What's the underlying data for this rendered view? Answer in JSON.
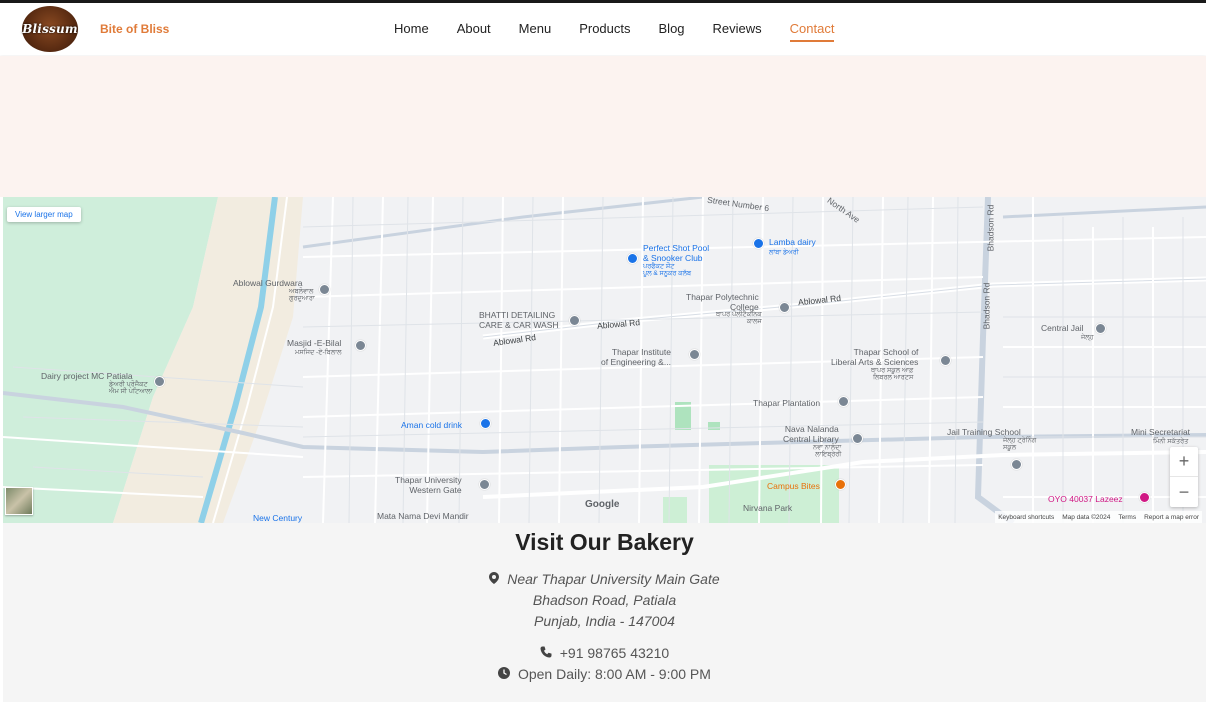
{
  "header": {
    "logo_text": "Blissum",
    "brand": "Bite of Bliss",
    "nav": [
      {
        "label": "Home",
        "active": false
      },
      {
        "label": "About",
        "active": false
      },
      {
        "label": "Menu",
        "active": false
      },
      {
        "label": "Products",
        "active": false
      },
      {
        "label": "Blog",
        "active": false
      },
      {
        "label": "Reviews",
        "active": false
      },
      {
        "label": "Contact",
        "active": true
      }
    ],
    "accent_color": "#e07b39"
  },
  "map": {
    "view_larger": "View larger map",
    "google": "Google",
    "zoom_in": "+",
    "zoom_out": "−",
    "attribution": [
      "Keyboard shortcuts",
      "Map data ©2024",
      "Terms",
      "Report a map error"
    ],
    "labels": {
      "street6": "Street Number 6",
      "north_ave": "North Ave",
      "bhadson_rd_top": "Bhadson Rd",
      "bhadson_rd_mid": "Bhadson Rd",
      "perfect_shot": "Perfect Shot Pool\n& Snooker Club",
      "perfect_shot_local": "ਪਰਫੈਕਟ ਸ਼ੌਟ\nਪੂਲ & ਸਨੂਕਰ ਕਲੱਬ",
      "lamba_dairy": "Lamba dairy",
      "lamba_dairy_local": "ਲਾਂਬਾ ਡੇਅਰੀ",
      "ablowal_gurdwara": "Ablowal Gurdwara",
      "ablowal_gurdwara_local": "ਅਬਲੋਵਾਲ\nਗੁਰਦੁਆਰਾ",
      "thapar_poly": "Thapar Polytechnic\nCollege",
      "thapar_poly_local": "ਥਾਪਰ ਪੌਲੀਟੈਕਨਿਕ\nਕਾਲਜ",
      "ablowal_rd_1": "Ablowal Rd",
      "ablowal_rd_2": "Ablowal Rd",
      "ablowal_rd_3": "Ablowal Rd",
      "bhatti": "BHATTI DETAILING\nCARE & CAR WASH",
      "masjid": "Masjid -E-Bilal",
      "masjid_local": "ਮਸਜਿਦ -ਏ-ਬਿਲਾਲ",
      "central_jail": "Central Jail",
      "central_jail_local": "ਜੇਲ੍ਹ",
      "thapar_inst": "Thapar Institute\nof Engineering &...",
      "thapar_school": "Thapar School of\nLiberal Arts & Sciences",
      "thapar_school_local": "ਥਾਪਰ ਸਕੂਲ ਆਫ਼\nਲਿਬਰਲ ਆਰਟਸ",
      "dairy_project": "Dairy project MC Patiala",
      "dairy_project_local": "ਡੇਅਰੀ ਪ੍ਰੋਜੈਕਟ\nਐਮ ਸੀ ਪਟਿਆਲਾ",
      "thapar_plantation": "Thapar Plantation",
      "aman": "Aman cold drink",
      "nava_nalanda": "Nava Nalanda\nCentral Library",
      "nava_nalanda_local": "ਨਵਾ ਨਾਲੰਦਾ\nਲਾਇਬ੍ਰੇਰੀ",
      "jail_training": "Jail Training School",
      "jail_training_local": "ਜੇਲ੍ਹ ਟ੍ਰੇਨਿੰਗ\nਸਕੂਲ",
      "mini_secretariat": "Mini Secretariat",
      "mini_secretariat_local": "ਮਿੰਨੀ ਸਕੱਤਰੇਤ",
      "thapar_gate": "Thapar University\nWestern Gate",
      "campus_bites": "Campus Bites",
      "oyo": "OYO 40037 Lazeez",
      "new_century": "New Century",
      "mata_nama": "Mata Nama Devi Mandir",
      "nirvana": "Nirvana Park"
    }
  },
  "contact": {
    "title": "Visit Our Bakery",
    "address_line1": "Near Thapar University Main Gate",
    "address_line2": "Bhadson Road, Patiala",
    "address_line3": "Punjab, India - 147004",
    "phone": "+91 98765 43210",
    "hours": "Open Daily: 8:00 AM - 9:00 PM",
    "icons": {
      "address": "map-marker-icon",
      "phone": "phone-icon",
      "hours": "clock-icon"
    }
  }
}
